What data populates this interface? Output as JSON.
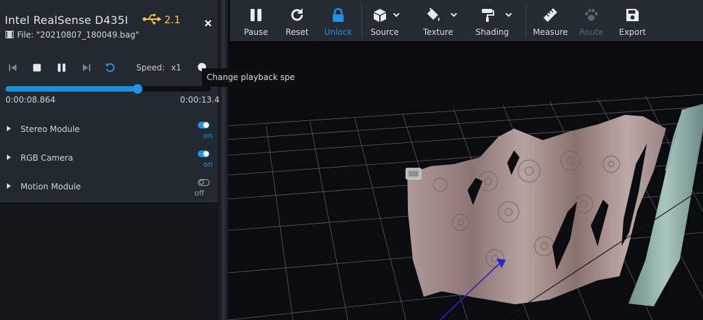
{
  "device": {
    "name": "Intel RealSense D435I",
    "usb_version": "2.1",
    "file_label": "File: \"20210807_180049.bag\""
  },
  "playback": {
    "speed_label": "Speed:",
    "speed_value": "x1",
    "tooltip": "Change playback speed",
    "progress": 0.644,
    "time_current": "0:00:08.864",
    "time_total": "0:00:13.4"
  },
  "modules": [
    {
      "label": "Stereo Module",
      "state": "on"
    },
    {
      "label": "RGB Camera",
      "state": "on"
    },
    {
      "label": "Motion Module",
      "state": "off"
    }
  ],
  "toolbar": {
    "pause": "Pause",
    "reset": "Reset",
    "unlock": "Unlock",
    "source": "Source",
    "texture": "Texture",
    "shading": "Shading",
    "measure": "Measure",
    "route": "Route",
    "export": "Export"
  },
  "colors": {
    "accent": "#1e93e6",
    "usb": "#ffc83a",
    "panel": "#232931",
    "toolbar": "#252b33"
  }
}
